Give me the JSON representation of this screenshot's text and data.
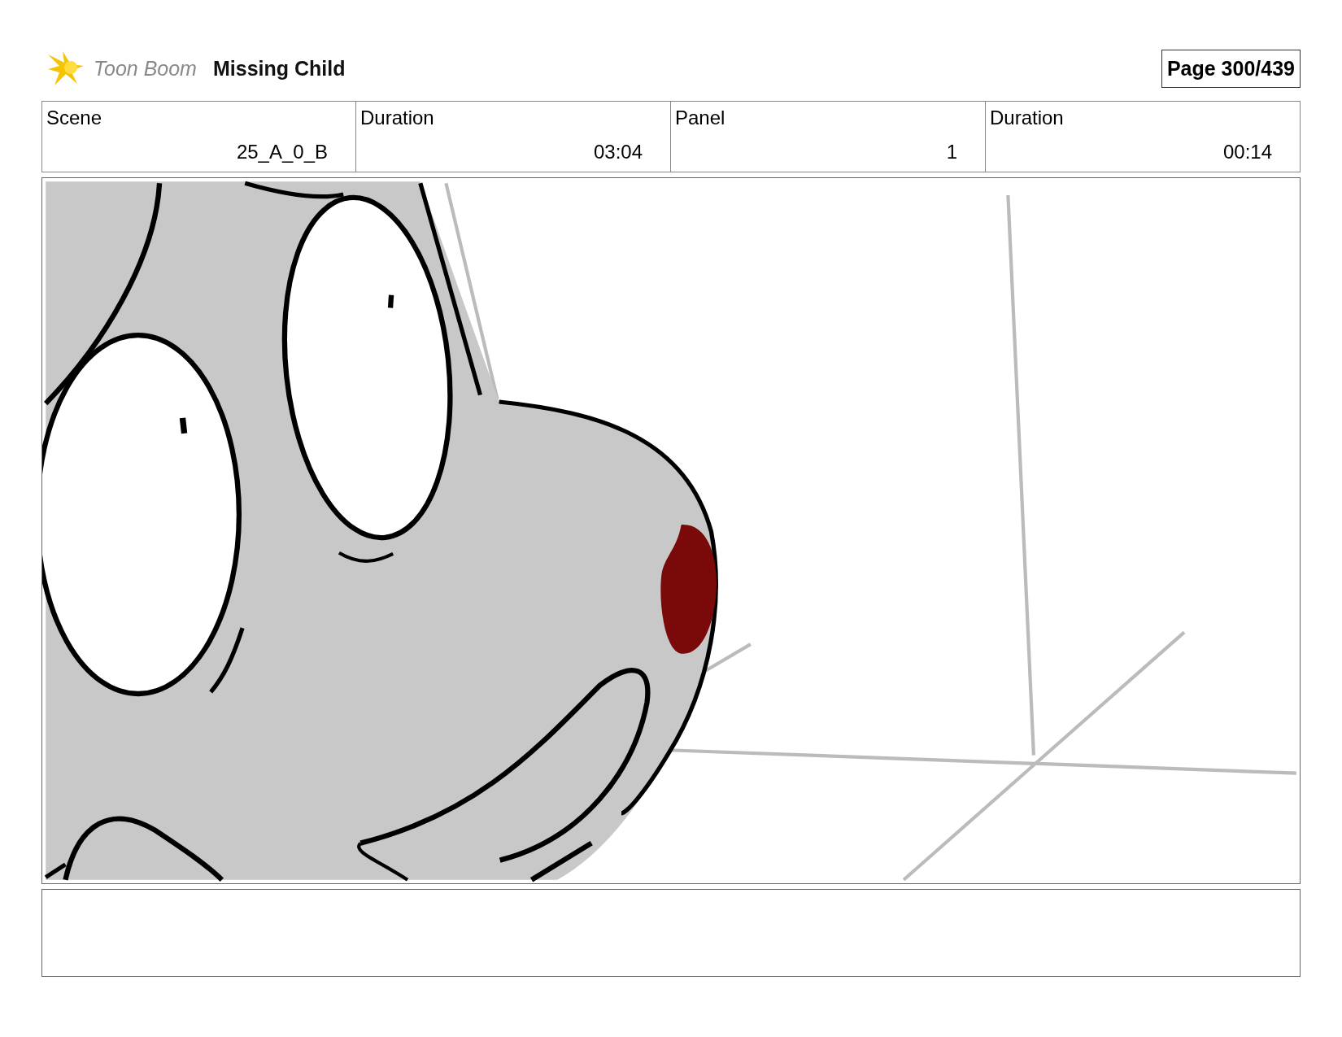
{
  "header": {
    "logo_text": "Toon Boom",
    "title": "Missing Child",
    "page": "Page 300/439"
  },
  "info": [
    {
      "label": "Scene",
      "value": "25_A_0_B"
    },
    {
      "label": "Duration",
      "value": "03:04"
    },
    {
      "label": "Panel",
      "value": "1"
    },
    {
      "label": "Duration",
      "value": "00:14"
    }
  ]
}
